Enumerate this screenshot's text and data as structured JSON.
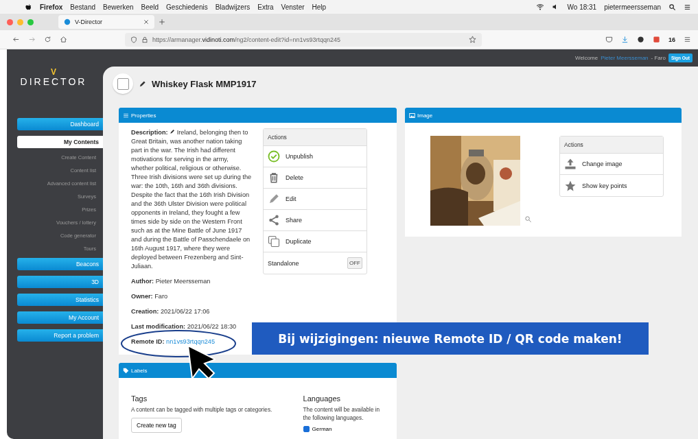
{
  "menubar": {
    "app_name": "Firefox",
    "menus": [
      "Bestand",
      "Bewerken",
      "Beeld",
      "Geschiedenis",
      "Bladwijzers",
      "Extra",
      "Venster",
      "Help"
    ],
    "clock": "Wo 18:31",
    "user": "pietermeersseman"
  },
  "browser": {
    "tab_title": "V-Director",
    "url_prefix": "https://armanager.",
    "url_domain": "vidinoti.com",
    "url_path": "/ng2/content-edit?id=nn1vs93rtqqn245",
    "badge": "16"
  },
  "header": {
    "welcome": "Welcome",
    "user": "Pieter Meersseman",
    "org": "- Faro",
    "sign_out": "Sign Out"
  },
  "logo": {
    "mark": "V",
    "name": "DIRECTOR"
  },
  "sidebar": {
    "items": [
      {
        "label": "Dashboard",
        "kind": "button",
        "selected": false
      },
      {
        "label": "My Contents",
        "kind": "button",
        "selected": true
      },
      {
        "label": "Create Content",
        "kind": "link"
      },
      {
        "label": "Content list",
        "kind": "link"
      },
      {
        "label": "Advanced content list",
        "kind": "link"
      },
      {
        "label": "Surveys",
        "kind": "link"
      },
      {
        "label": "Prizes",
        "kind": "link"
      },
      {
        "label": "Vouchers / lottery",
        "kind": "link"
      },
      {
        "label": "Code generator",
        "kind": "link"
      },
      {
        "label": "Tours",
        "kind": "link"
      },
      {
        "label": "Beacons",
        "kind": "button",
        "selected": false
      },
      {
        "label": "3D",
        "kind": "button",
        "selected": false
      },
      {
        "label": "Statistics",
        "kind": "button",
        "selected": false
      },
      {
        "label": "My Account",
        "kind": "button",
        "selected": false
      },
      {
        "label": "Report a problem",
        "kind": "button",
        "selected": false
      }
    ]
  },
  "content": {
    "title": "Whiskey Flask MMP1917",
    "checked": false
  },
  "properties": {
    "title": "Properties",
    "description_label": "Description:",
    "description": "Ireland, belonging then to Great Britain, was another nation taking part in the war. The Irish had different motivations for serving in the army, whether political, religious or otherwise. Three Irish divisions were set up during the war: the 10th, 16th and 36th divisions. Despite the fact that the 16th Irish Division and the 36th Ulster Division were political opponents in Ireland, they fought a few times side by side on the Western Front such as at the Mine Battle of June 1917 and during the Battle of Passchendaele on 16th August 1917, where they were deployed between Frezenberg and Sint-Juliaan.",
    "fields": [
      {
        "label": "Author:",
        "value": "Pieter Meersseman"
      },
      {
        "label": "Owner:",
        "value": "Faro"
      },
      {
        "label": "Creation:",
        "value": "2021/06/22 17:06"
      },
      {
        "label": "Last modification:",
        "value": "2021/06/22 18:30"
      }
    ],
    "remote_id": {
      "label": "Remote ID:",
      "value": "nn1vs93rtqqn245"
    },
    "actions": {
      "title": "Actions",
      "items": [
        {
          "label": "Unpublish",
          "kind": "check"
        },
        {
          "label": "Delete",
          "kind": "trash"
        },
        {
          "label": "Edit",
          "kind": "pencil"
        },
        {
          "label": "Share",
          "kind": "share"
        },
        {
          "label": "Duplicate",
          "kind": "copy"
        }
      ],
      "standalone": {
        "label": "Standalone",
        "toggle": "OFF",
        "on": false
      }
    }
  },
  "image": {
    "title": "Image",
    "actions": {
      "title": "Actions",
      "items": [
        {
          "label": "Change image",
          "kind": "upload"
        },
        {
          "label": "Show key points",
          "kind": "star"
        }
      ]
    }
  },
  "labels": {
    "title": "Labels",
    "tags": {
      "title": "Tags",
      "text": "A content can be tagged with multiple tags or categories.",
      "button": "Create new tag"
    },
    "languages": {
      "title": "Languages",
      "text": "The content will be available in the following languages.",
      "items": [
        {
          "label": "German",
          "checked": true
        }
      ]
    }
  },
  "annotation": {
    "text": "Bij wijzigingen: nieuwe Remote ID / QR code maken!"
  }
}
